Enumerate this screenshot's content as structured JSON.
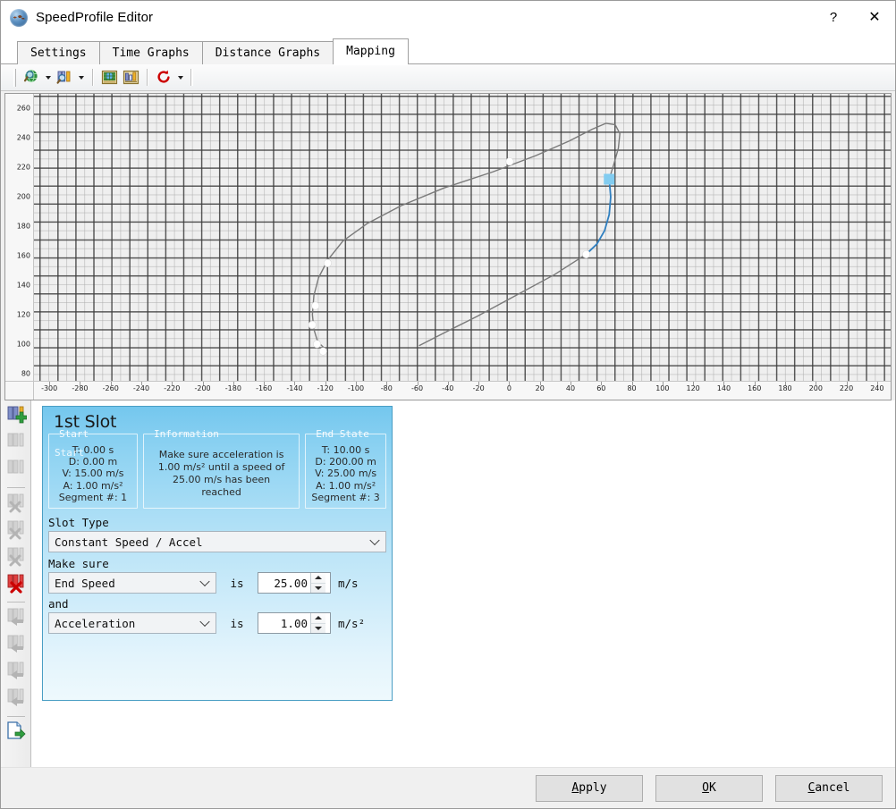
{
  "window": {
    "title": "SpeedProfile Editor",
    "app_icon": "globe-app-icon",
    "help_label": "?",
    "close_label": "✕"
  },
  "tabs": [
    {
      "label": "Settings",
      "active": false
    },
    {
      "label": "Time Graphs",
      "active": false
    },
    {
      "label": "Distance Graphs",
      "active": false
    },
    {
      "label": "Mapping",
      "active": true
    }
  ],
  "toolbar": {
    "items": [
      {
        "name": "zoom-world-icon",
        "has_dropdown": true
      },
      {
        "name": "zoom-slot-icon",
        "has_dropdown": true
      },
      {
        "name": "map-view-icon",
        "has_dropdown": false
      },
      {
        "name": "ruler-chart-icon",
        "has_dropdown": false
      },
      {
        "name": "refresh-icon",
        "has_dropdown": true
      }
    ]
  },
  "chart_data": {
    "type": "line",
    "title": "",
    "xlabel": "",
    "ylabel": "",
    "grid": true,
    "legend": "none",
    "xlim": [
      -310,
      250
    ],
    "ylim": [
      75,
      270
    ],
    "xticks": [
      -300,
      -280,
      -260,
      -240,
      -220,
      -200,
      -180,
      -160,
      -140,
      -120,
      -100,
      -80,
      -60,
      -40,
      -20,
      0,
      20,
      40,
      60,
      80,
      100,
      120,
      140,
      160,
      180,
      200,
      220,
      240
    ],
    "yticks": [
      260,
      240,
      220,
      200,
      180,
      160,
      140,
      120,
      100,
      80
    ],
    "series": [
      {
        "name": "route-path",
        "color": "#7a7a7a",
        "points": [
          [
            -121,
            95
          ],
          [
            -120,
            97
          ],
          [
            -123,
            100
          ],
          [
            -125,
            103
          ],
          [
            -127,
            110
          ],
          [
            -128,
            120
          ],
          [
            -127,
            133
          ],
          [
            -124,
            145
          ],
          [
            -118,
            157
          ],
          [
            -108,
            170
          ],
          [
            -92,
            182
          ],
          [
            -70,
            194
          ],
          [
            -42,
            206
          ],
          [
            -10,
            217
          ],
          [
            18,
            228
          ],
          [
            40,
            238
          ],
          [
            55,
            246
          ],
          [
            64,
            250
          ],
          [
            70,
            249
          ],
          [
            73,
            243
          ],
          [
            72,
            233
          ],
          [
            69,
            222
          ],
          [
            66,
            212
          ]
        ]
      },
      {
        "name": "selected-segment",
        "color": "#2f7fc0",
        "points": [
          [
            66,
            212
          ],
          [
            67,
            200
          ],
          [
            66,
            188
          ],
          [
            63,
            177
          ],
          [
            58,
            168
          ],
          [
            51,
            161
          ]
        ]
      },
      {
        "name": "return-path",
        "color": "#7a7a7a",
        "points": [
          [
            51,
            161
          ],
          [
            30,
            147
          ],
          [
            5,
            133
          ],
          [
            -20,
            119
          ],
          [
            -43,
            107
          ],
          [
            -58,
            99
          ]
        ]
      }
    ],
    "waypoints": [
      {
        "x": -121,
        "y": 95,
        "marker": "circle"
      },
      {
        "x": -125,
        "y": 100,
        "marker": "circle"
      },
      {
        "x": -128,
        "y": 113,
        "marker": "circle"
      },
      {
        "x": -126,
        "y": 126,
        "marker": "circle"
      },
      {
        "x": -118,
        "y": 155,
        "marker": "circle"
      },
      {
        "x": 1,
        "y": 224,
        "marker": "circle"
      },
      {
        "x": 51,
        "y": 161,
        "marker": "circle"
      }
    ],
    "selected_marker": {
      "x": 66,
      "y": 212,
      "marker": "square",
      "color": "#82ccf0"
    }
  },
  "sidebar": {
    "items": [
      {
        "name": "add-slot",
        "icon": "slot-add-icon",
        "enabled": true
      },
      {
        "name": "insert-slot-before",
        "icon": "slot-insert-before-icon",
        "enabled": false
      },
      {
        "name": "insert-slot-after",
        "icon": "slot-insert-after-icon",
        "enabled": false
      },
      {
        "name": "separator-1",
        "icon": "separator",
        "enabled": false
      },
      {
        "name": "cut-slot",
        "icon": "slot-cut-icon",
        "enabled": false
      },
      {
        "name": "cut-slot-before",
        "icon": "slot-cut-before-icon",
        "enabled": false
      },
      {
        "name": "cut-slot-after",
        "icon": "slot-cut-after-icon",
        "enabled": false
      },
      {
        "name": "delete-slot",
        "icon": "slot-delete-icon",
        "enabled": true
      },
      {
        "name": "separator-2",
        "icon": "separator",
        "enabled": false
      },
      {
        "name": "move-slot-first",
        "icon": "slot-move-first-icon",
        "enabled": false
      },
      {
        "name": "move-slot-previous",
        "icon": "slot-move-prev-icon",
        "enabled": false
      },
      {
        "name": "move-slot-next",
        "icon": "slot-move-next-icon",
        "enabled": false
      },
      {
        "name": "move-slot-last",
        "icon": "slot-move-last-icon",
        "enabled": false
      },
      {
        "name": "separator-3",
        "icon": "separator",
        "enabled": false
      },
      {
        "name": "export-slot",
        "icon": "export-icon",
        "enabled": true
      }
    ]
  },
  "slot_panel": {
    "title": "1st Slot",
    "ghost_text": "Start",
    "start": {
      "legend": "Start",
      "lines": [
        "T: 0.00 s",
        "D: 0.00 m",
        "V: 15.00 m/s",
        "A: 1.00 m/s²",
        "Segment #: 1"
      ]
    },
    "information": {
      "legend": "Information",
      "text": "Make sure acceleration is 1.00 m/s² until a speed of 25.00 m/s has been reached"
    },
    "end_state": {
      "legend": "End State",
      "lines": [
        "T: 10.00 s",
        "D: 200.00 m",
        "V: 25.00 m/s",
        "A: 1.00 m/s²",
        "Segment #: 3"
      ]
    },
    "slot_type_label": "Slot Type",
    "slot_type_value": "Constant Speed / Accel",
    "make_sure_label": "Make sure",
    "and_label": "and",
    "condition_1": {
      "property": "End Speed",
      "is_word": "is",
      "value": "25.00",
      "unit": "m/s"
    },
    "condition_2": {
      "property": "Acceleration",
      "is_word": "is",
      "value": "1.00",
      "unit": "m/s²"
    }
  },
  "footer": {
    "apply": {
      "pre": "",
      "accel": "A",
      "post": "pply"
    },
    "ok": {
      "pre": "",
      "accel": "O",
      "post": "K"
    },
    "cancel": {
      "pre": "",
      "accel": "C",
      "post": "ancel"
    }
  },
  "colors": {
    "panel_accent": "#74c7ee",
    "selection": "#82ccf0",
    "selected_segment": "#2f7fc0",
    "path": "#7a7a7a"
  }
}
